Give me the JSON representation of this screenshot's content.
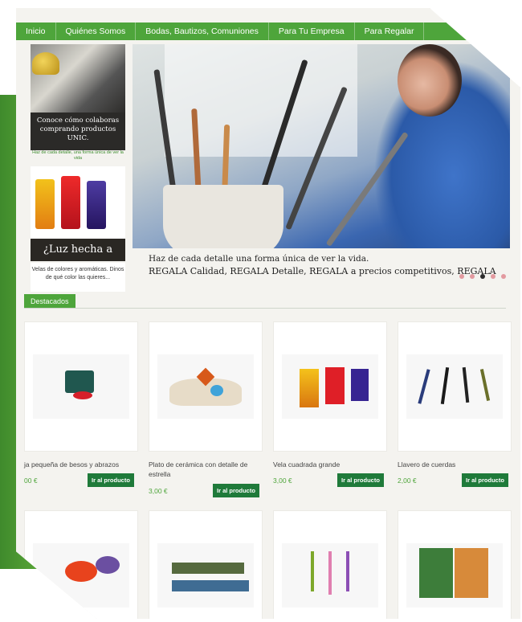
{
  "nav": {
    "items": [
      "Inicio",
      "Quiénes Somos",
      "Bodas, Bautizos, Comuniones",
      "Para Tu Empresa",
      "Para Regalar"
    ]
  },
  "sidebar": {
    "promo1_caption": "Conoce cómo colaboras comprando productos UNIC.",
    "promo1_tagline": "Haz de cada detalle, una forma única de ver la vida",
    "promo2_title": "¿Luz hecha a mano?",
    "promo2_text": "Velas de colores y aromáticas. Dinos de qué color las quieres..."
  },
  "hero": {
    "line1": "Haz de cada detalle una forma única de ver la vida.",
    "line2": "REGALA Calidad, REGALA Detalle, REGALA a precios competitivos, REGALA",
    "slide_count": 5,
    "active_slide": 3
  },
  "section": {
    "title": "Destacados"
  },
  "products": [
    {
      "name": "ja pequeña de besos y abrazos",
      "price": "00 €",
      "button": "Ir al producto"
    },
    {
      "name": "Plato de cerámica con detalle de estrella",
      "price": "3,00 €",
      "button": "Ir al producto"
    },
    {
      "name": "Vela cuadrada grande",
      "price": "3,00 €",
      "button": "Ir al producto"
    },
    {
      "name": "Llavero de cuerdas",
      "price": "2,00 €",
      "button": "Ir al producto"
    }
  ],
  "colors": {
    "brand_green": "#4ea53b",
    "button_green": "#1f7a3a"
  }
}
